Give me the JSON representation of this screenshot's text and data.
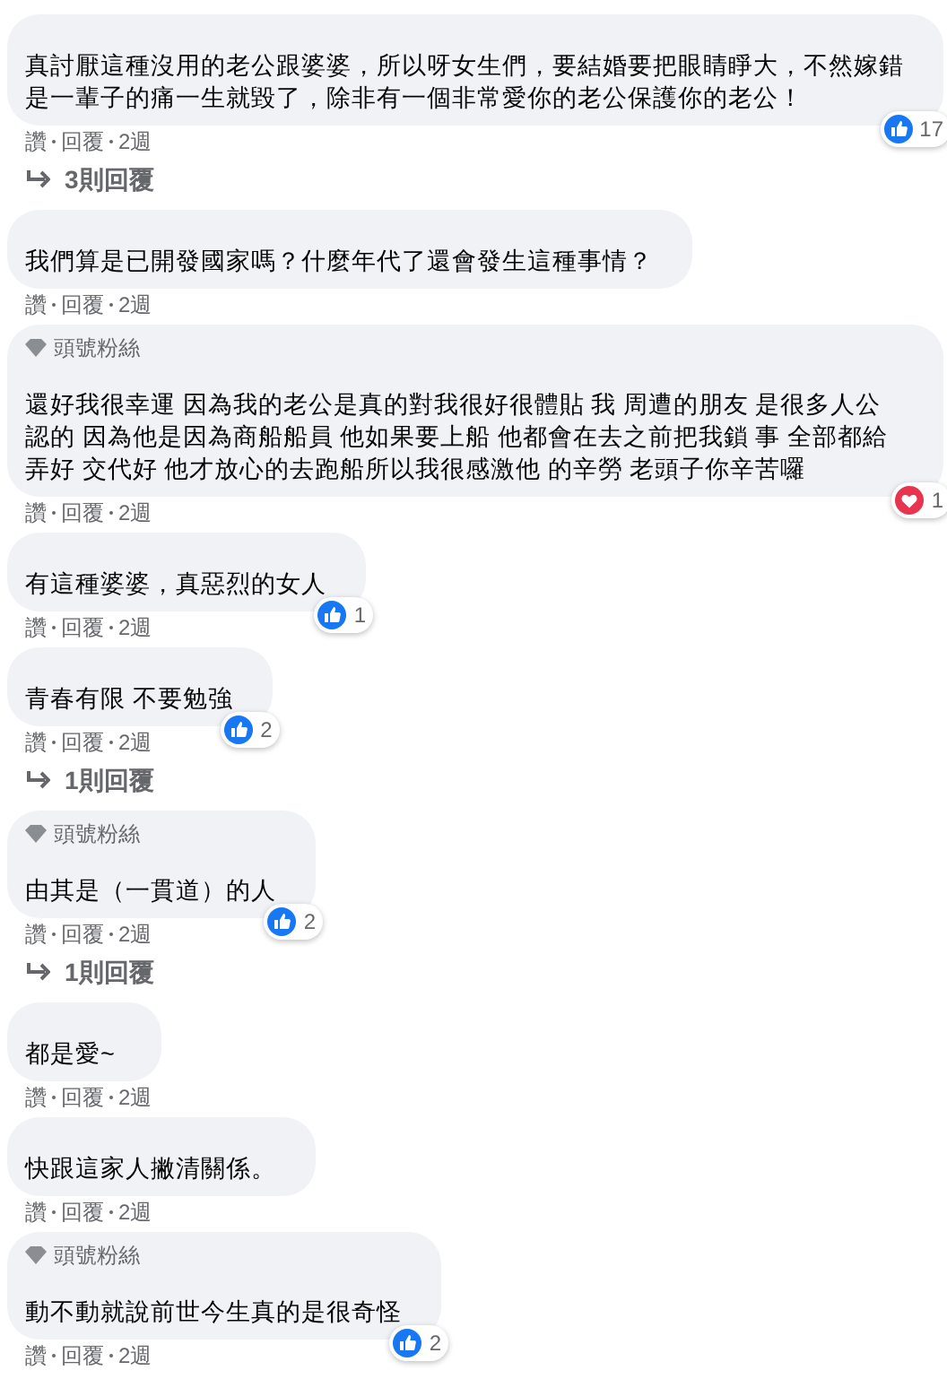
{
  "comments": [
    {
      "text": "真討厭這種沒用的老公跟婆婆，所以呀女生們，要結婚要把眼睛睜大，不然嫁錯是一輩子的痛一生就毀了，除非有一個非常愛你的老公保護你的老公！",
      "reaction": {
        "kind": "like",
        "count": "17"
      },
      "actions": [
        "讚",
        "回覆",
        "2週"
      ],
      "replies": "3則回覆"
    },
    {
      "text": "我們算是已開發國家嗎？什麼年代了還會發生這種事情？",
      "actions": [
        "讚",
        "回覆",
        "2週"
      ]
    },
    {
      "badge": "頭號粉絲",
      "text": "還好我很幸運 因為我的老公是真的對我很好很體貼 我 周遭的朋友 是很多人公認的 因為他是因為商船船員 他如果要上船 他都會在去之前把我鎖 事 全部都給弄好 交代好 他才放心的去跑船所以我很感激他 的辛勞 老頭子你辛苦囉",
      "reaction": {
        "kind": "love",
        "count": "1"
      },
      "actions": [
        "讚",
        "回覆",
        "2週"
      ]
    },
    {
      "text": "有這種婆婆，真惡烈的女人",
      "reaction": {
        "kind": "like",
        "count": "1"
      },
      "actions": [
        "讚",
        "回覆",
        "2週"
      ]
    },
    {
      "text": "青春有限 不要勉強",
      "reaction": {
        "kind": "like",
        "count": "2"
      },
      "actions": [
        "讚",
        "回覆",
        "2週"
      ],
      "replies": "1則回覆"
    },
    {
      "badge": "頭號粉絲",
      "text": "由其是（一貫道）的人",
      "reaction": {
        "kind": "like",
        "count": "2"
      },
      "actions": [
        "讚",
        "回覆",
        "2週"
      ],
      "replies": "1則回覆"
    },
    {
      "text": "都是愛~",
      "actions": [
        "讚",
        "回覆",
        "2週"
      ]
    },
    {
      "text": "快跟這家人撇清關係。",
      "actions": [
        "讚",
        "回覆",
        "2週"
      ]
    },
    {
      "badge": "頭號粉絲",
      "text": "動不動就說前世今生真的是很奇怪",
      "reaction": {
        "kind": "like",
        "count": "2"
      },
      "actions": [
        "讚",
        "回覆",
        "2週"
      ]
    }
  ]
}
